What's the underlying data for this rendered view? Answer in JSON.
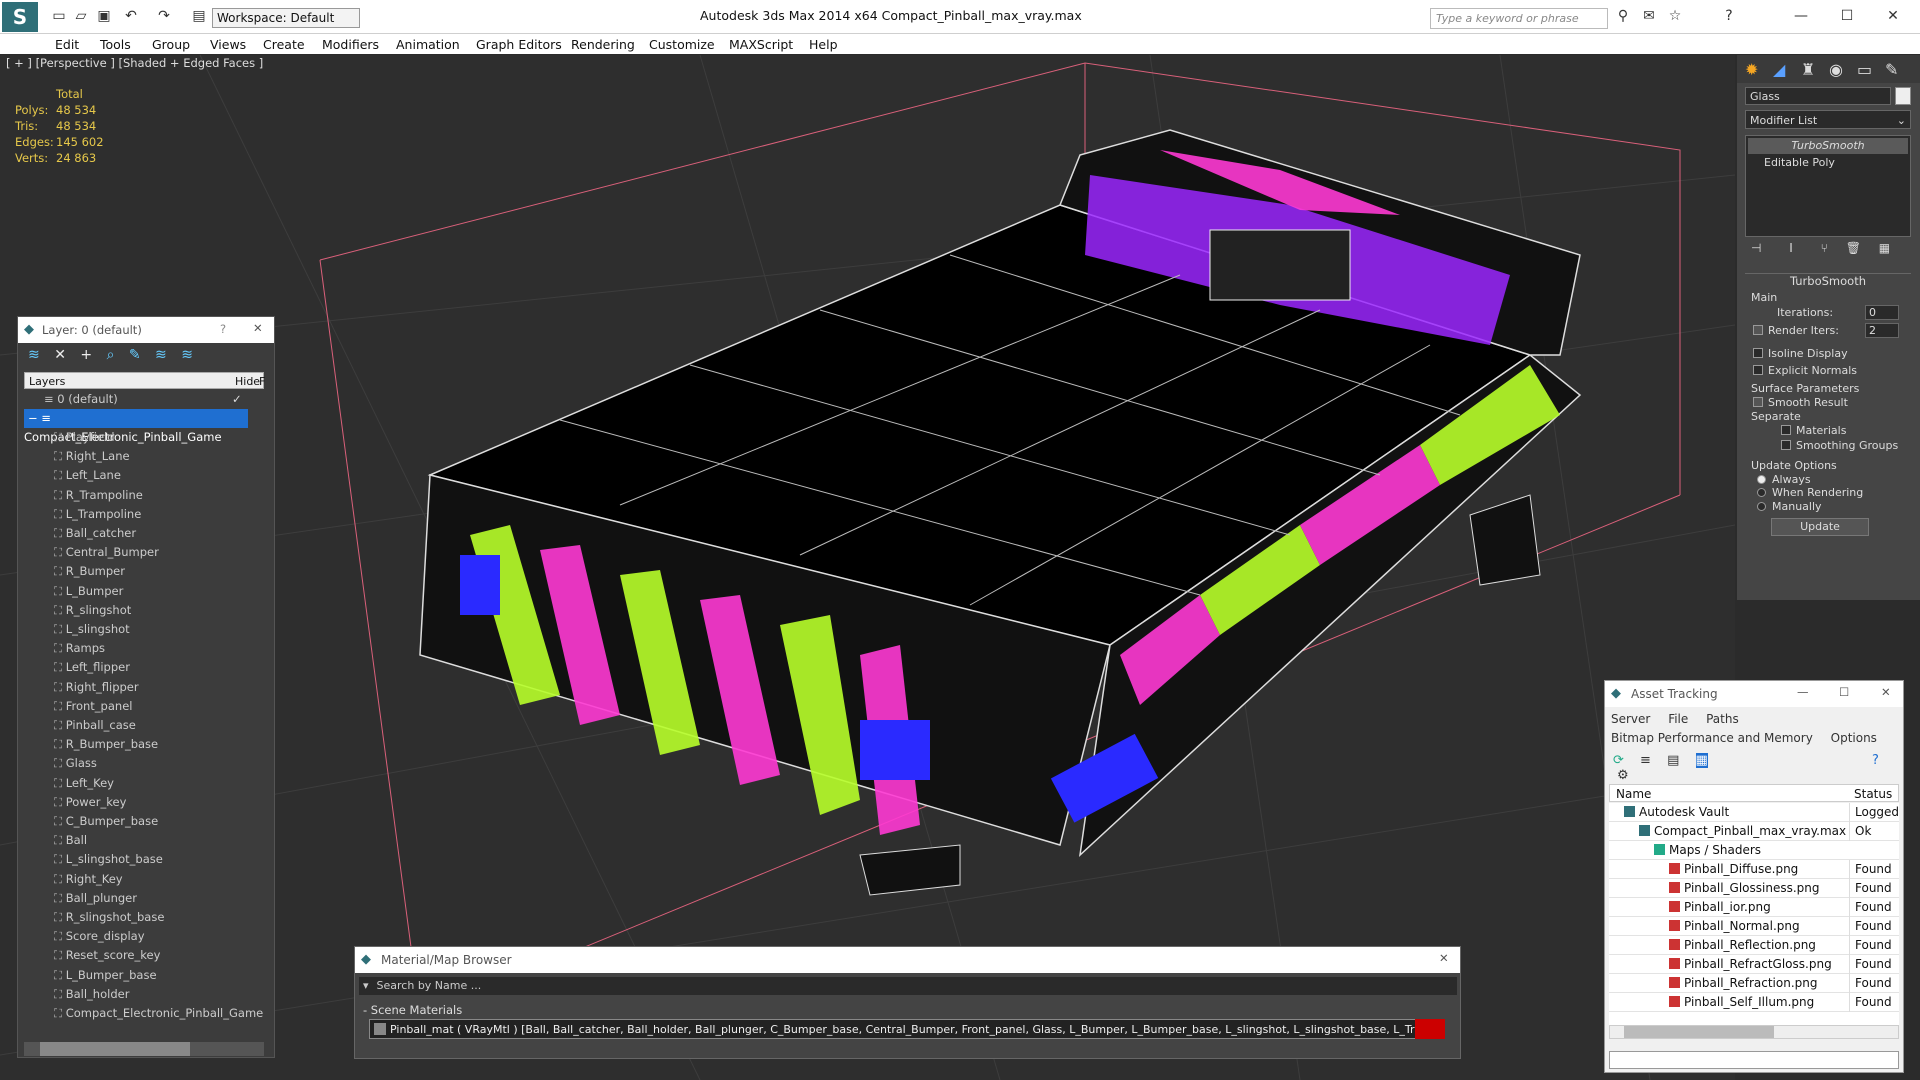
{
  "titlebar": {
    "workspace": "Workspace: Default",
    "title": "Autodesk 3ds Max  2014 x64      Compact_Pinball_max_vray.max",
    "search_placeholder": "Type a keyword or phrase"
  },
  "menu": [
    "Edit",
    "Tools",
    "Group",
    "Views",
    "Create",
    "Modifiers",
    "Animation",
    "Graph Editors",
    "Rendering",
    "Customize",
    "MAXScript",
    "Help"
  ],
  "viewport": {
    "label": "[ + ] [Perspective ] [Shaded + Edged Faces ]",
    "stats": {
      "header": "Total",
      "polys_label": "Polys:",
      "polys": "48 534",
      "tris_label": "Tris:",
      "tris": "48 534",
      "edges_label": "Edges:",
      "edges": "145 602",
      "verts_label": "Verts:",
      "verts": "24 863"
    }
  },
  "command_panel": {
    "object_name": "Glass",
    "modifier_list": "Modifier List",
    "stack": [
      "TurboSmooth",
      "Editable Poly"
    ],
    "rollout_title": "TurboSmooth",
    "main_label": "Main",
    "iterations_label": "Iterations:",
    "iterations": "0",
    "render_iters_label": "Render Iters:",
    "render_iters": "2",
    "isoline": "Isoline Display",
    "explicit_normals": "Explicit Normals",
    "surface_params": "Surface Parameters",
    "smooth_result": "Smooth Result",
    "separate": "Separate",
    "materials": "Materials",
    "smoothing_groups": "Smoothing Groups",
    "update_options": "Update Options",
    "always": "Always",
    "when_rendering": "When Rendering",
    "manually": "Manually",
    "update_button": "Update"
  },
  "layers": {
    "title": "Layer: 0 (default)",
    "help": "?",
    "col_layers": "Layers",
    "col_hide": "Hide",
    "col_f": "F",
    "default_layer": "0 (default)",
    "selected_layer": "Compact_Electronic_Pinball_Game",
    "items": [
      "Playfield",
      "Right_Lane",
      "Left_Lane",
      "R_Trampoline",
      "L_Trampoline",
      "Ball_catcher",
      "Central_Bumper",
      "R_Bumper",
      "L_Bumper",
      "R_slingshot",
      "L_slingshot",
      "Ramps",
      "Left_flipper",
      "Right_flipper",
      "Front_panel",
      "Pinball_case",
      "R_Bumper_base",
      "Glass",
      "Left_Key",
      "Power_key",
      "C_Bumper_base",
      "Ball",
      "L_slingshot_base",
      "Right_Key",
      "Ball_plunger",
      "R_slingshot_base",
      "Score_display",
      "Reset_score_key",
      "L_Bumper_base",
      "Ball_holder",
      "Compact_Electronic_Pinball_Game"
    ]
  },
  "asset_tracking": {
    "title": "Asset Tracking",
    "menu": [
      "Server",
      "File",
      "Paths"
    ],
    "menu2": [
      "Bitmap Performance and Memory",
      "Options"
    ],
    "col_name": "Name",
    "col_status": "Status",
    "rows": [
      {
        "name": "Autodesk Vault",
        "status": "Logged",
        "indent": 1
      },
      {
        "name": "Compact_Pinball_max_vray.max",
        "status": "Ok",
        "indent": 2
      },
      {
        "name": "Maps / Shaders",
        "status": "",
        "indent": 3
      },
      {
        "name": "Pinball_Diffuse.png",
        "status": "Found",
        "indent": 4
      },
      {
        "name": "Pinball_Glossiness.png",
        "status": "Found",
        "indent": 4
      },
      {
        "name": "Pinball_ior.png",
        "status": "Found",
        "indent": 4
      },
      {
        "name": "Pinball_Normal.png",
        "status": "Found",
        "indent": 4
      },
      {
        "name": "Pinball_Reflection.png",
        "status": "Found",
        "indent": 4
      },
      {
        "name": "Pinball_RefractGloss.png",
        "status": "Found",
        "indent": 4
      },
      {
        "name": "Pinball_Refraction.png",
        "status": "Found",
        "indent": 4
      },
      {
        "name": "Pinball_Self_Illum.png",
        "status": "Found",
        "indent": 4
      }
    ]
  },
  "material_browser": {
    "title": "Material/Map Browser",
    "search": "Search by Name ...",
    "section": "- Scene Materials",
    "entry": "Pinball_mat ( VRayMtl ) [Ball, Ball_catcher, Ball_holder, Ball_plunger, C_Bumper_base, Central_Bumper, Front_panel, Glass, L_Bumper, L_Bumper_base, L_slingshot, L_slingshot_base, L_Trampoline, Left_fl..."
  },
  "colors": {
    "accent": "#3399ff",
    "viewport_bg": "#2e2e2e",
    "stats": "#e6c84a",
    "selection": "#1f6fd1"
  }
}
